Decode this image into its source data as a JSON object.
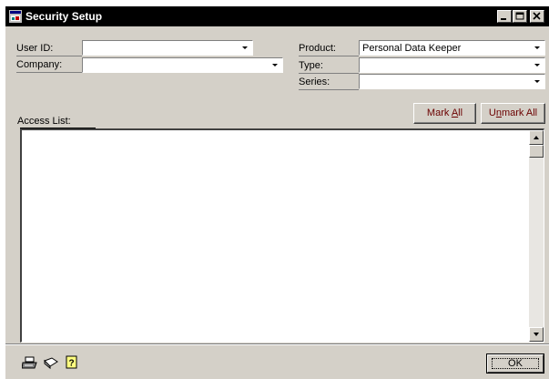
{
  "window": {
    "title": "Security Setup"
  },
  "form": {
    "user_id_label": "User ID:",
    "user_id_value": "",
    "company_label": "Company:",
    "company_value": "",
    "product_label": "Product:",
    "product_value": "Personal Data Keeper",
    "type_label": "Type:",
    "type_value": "",
    "series_label": "Series:",
    "series_value": ""
  },
  "buttons": {
    "mark_all_pre": "Mark ",
    "mark_all_u": "A",
    "mark_all_post": "ll",
    "unmark_all_pre": "U",
    "unmark_all_u": "n",
    "unmark_all_post": "mark All",
    "ok": "OK"
  },
  "list": {
    "label": "Access List:",
    "items": []
  },
  "icons": [
    "window-icon",
    "minimize-icon",
    "maximize-icon",
    "close-icon",
    "print-icon",
    "note-icon",
    "help-icon"
  ]
}
